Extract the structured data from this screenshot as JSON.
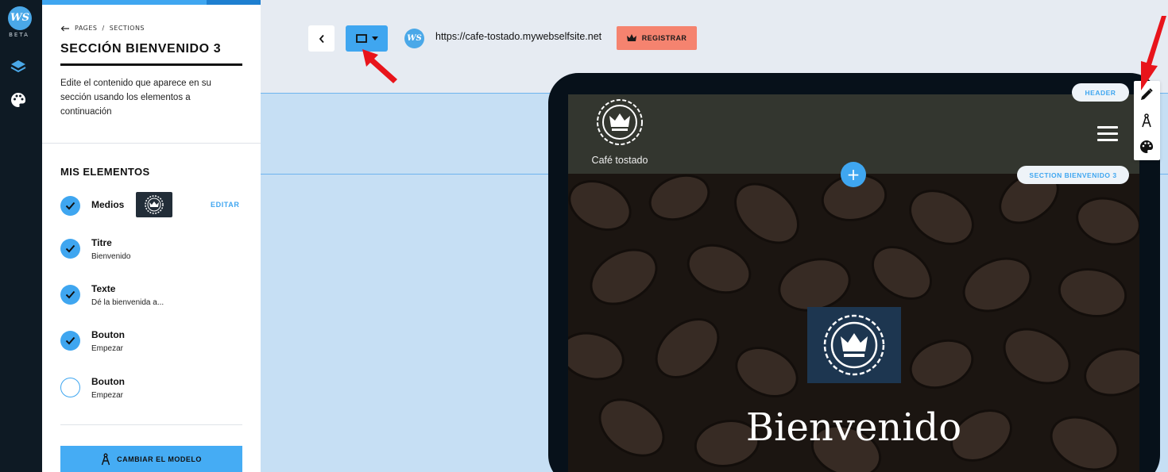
{
  "app": {
    "logo_text": "WS",
    "beta_label": "BETA",
    "rail_icons": [
      "layers-icon",
      "palette-icon"
    ]
  },
  "panel": {
    "breadcrumb": {
      "back_icon": "arrow-left-icon",
      "pages": "PAGES",
      "separator": "/",
      "sections": "SECTIONS"
    },
    "title": "SECCIÓN BIENVENIDO 3",
    "description": "Edite el contenido que aparece en su sección usando los elementos a continuación",
    "elements_heading": "MIS ELEMENTOS",
    "elements": [
      {
        "name": "Medios",
        "sub": "",
        "checked": true,
        "edit_label": "EDITAR"
      },
      {
        "name": "Titre",
        "sub": "Bienvenido",
        "checked": true
      },
      {
        "name": "Texte",
        "sub": "Dé la bienvenida a...",
        "checked": true
      },
      {
        "name": "Bouton",
        "sub": "Empezar",
        "checked": true
      },
      {
        "name": "Bouton",
        "sub": "Empezar",
        "checked": false
      }
    ],
    "change_model_label": "CAMBIAR EL MODELO"
  },
  "toolbar": {
    "back_icon": "chevron-left-icon",
    "device_icon": "desktop-icon",
    "url": "https://cafe-tostado.mywebselfsite.net",
    "register_label": "REGISTRAR",
    "register_icon": "crown-icon"
  },
  "preview": {
    "brand_name": "Café tostado",
    "hero_title": "Bienvenido",
    "header_tag": "HEADER",
    "section_tag": "SECTION BIENVENIDO 3",
    "add_section_symbol": "+"
  },
  "side_tools": [
    "pencil-icon",
    "compass-icon",
    "palette-icon"
  ],
  "colors": {
    "accent": "#3fa6f0",
    "register": "#f5836f",
    "rail": "#0e1a24",
    "section_highlight": "#c6dff4",
    "hero_logo_bg": "#1d3650"
  }
}
